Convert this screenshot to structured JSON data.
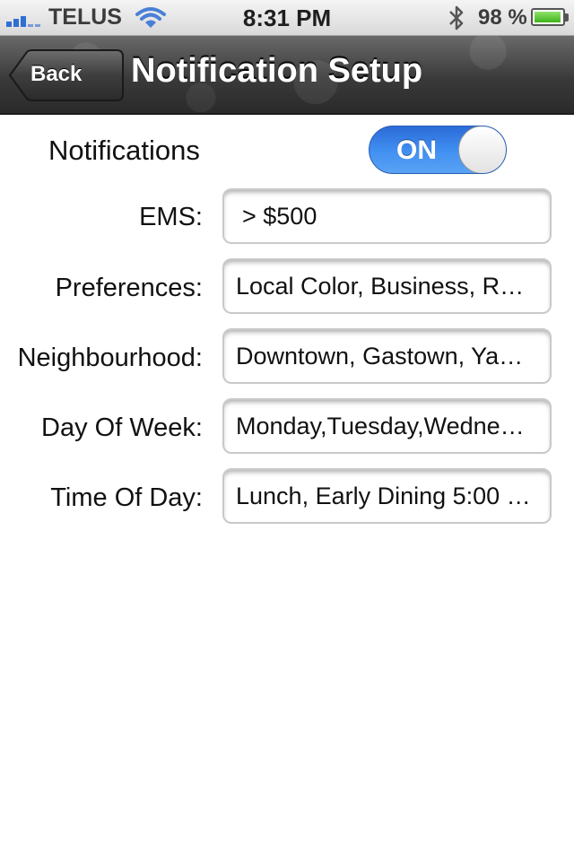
{
  "status_bar": {
    "carrier": "TELUS",
    "time": "8:31 PM",
    "battery_percent": "98 %",
    "icons": [
      "signal-icon",
      "wifi-icon",
      "bluetooth-icon",
      "battery-icon"
    ],
    "battery_level": 0.98
  },
  "nav": {
    "back_label": "Back",
    "title": "Notification Setup"
  },
  "notifications": {
    "label": "Notifications",
    "toggle_text": "ON",
    "enabled": true,
    "accent_color": "#3f8ef0"
  },
  "form": {
    "ems": {
      "label": "EMS:",
      "value": "> $500"
    },
    "preferences": {
      "label": "Preferences:",
      "value": "Local Color, Business, R…"
    },
    "neighbourhood": {
      "label": "Neighbourhood:",
      "value": "Downtown, Gastown, Ya…"
    },
    "day_of_week": {
      "label": "Day Of Week:",
      "value": "Monday,Tuesday,Wedne…"
    },
    "time_of_day": {
      "label": "Time Of Day:",
      "value": "Lunch, Early Dining 5:00 …"
    }
  }
}
